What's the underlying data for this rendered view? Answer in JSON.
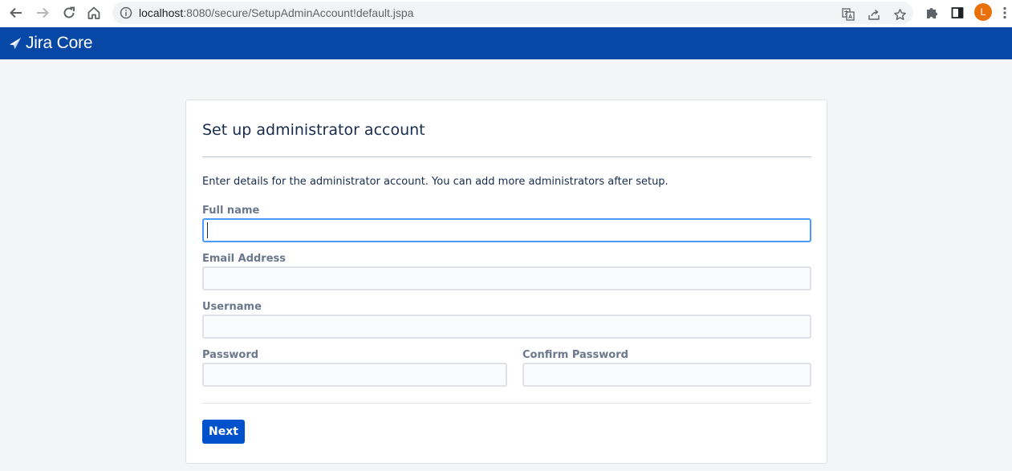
{
  "browser": {
    "url_host": "localhost",
    "url_rest": ":8080/secure/SetupAdminAccount!default.jspa",
    "profile_initial": "L"
  },
  "header": {
    "product_name": "Jira Core",
    "bg_color": "#0747a6"
  },
  "form": {
    "title": "Set up administrator account",
    "intro": "Enter details for the administrator account. You can add more administrators after setup.",
    "fields": {
      "full_name": {
        "label": "Full name",
        "value": ""
      },
      "email": {
        "label": "Email Address",
        "value": ""
      },
      "username": {
        "label": "Username",
        "value": ""
      },
      "password": {
        "label": "Password",
        "value": ""
      },
      "confirm_password": {
        "label": "Confirm Password",
        "value": ""
      }
    },
    "next_label": "Next",
    "accent_color": "#0052cc"
  }
}
